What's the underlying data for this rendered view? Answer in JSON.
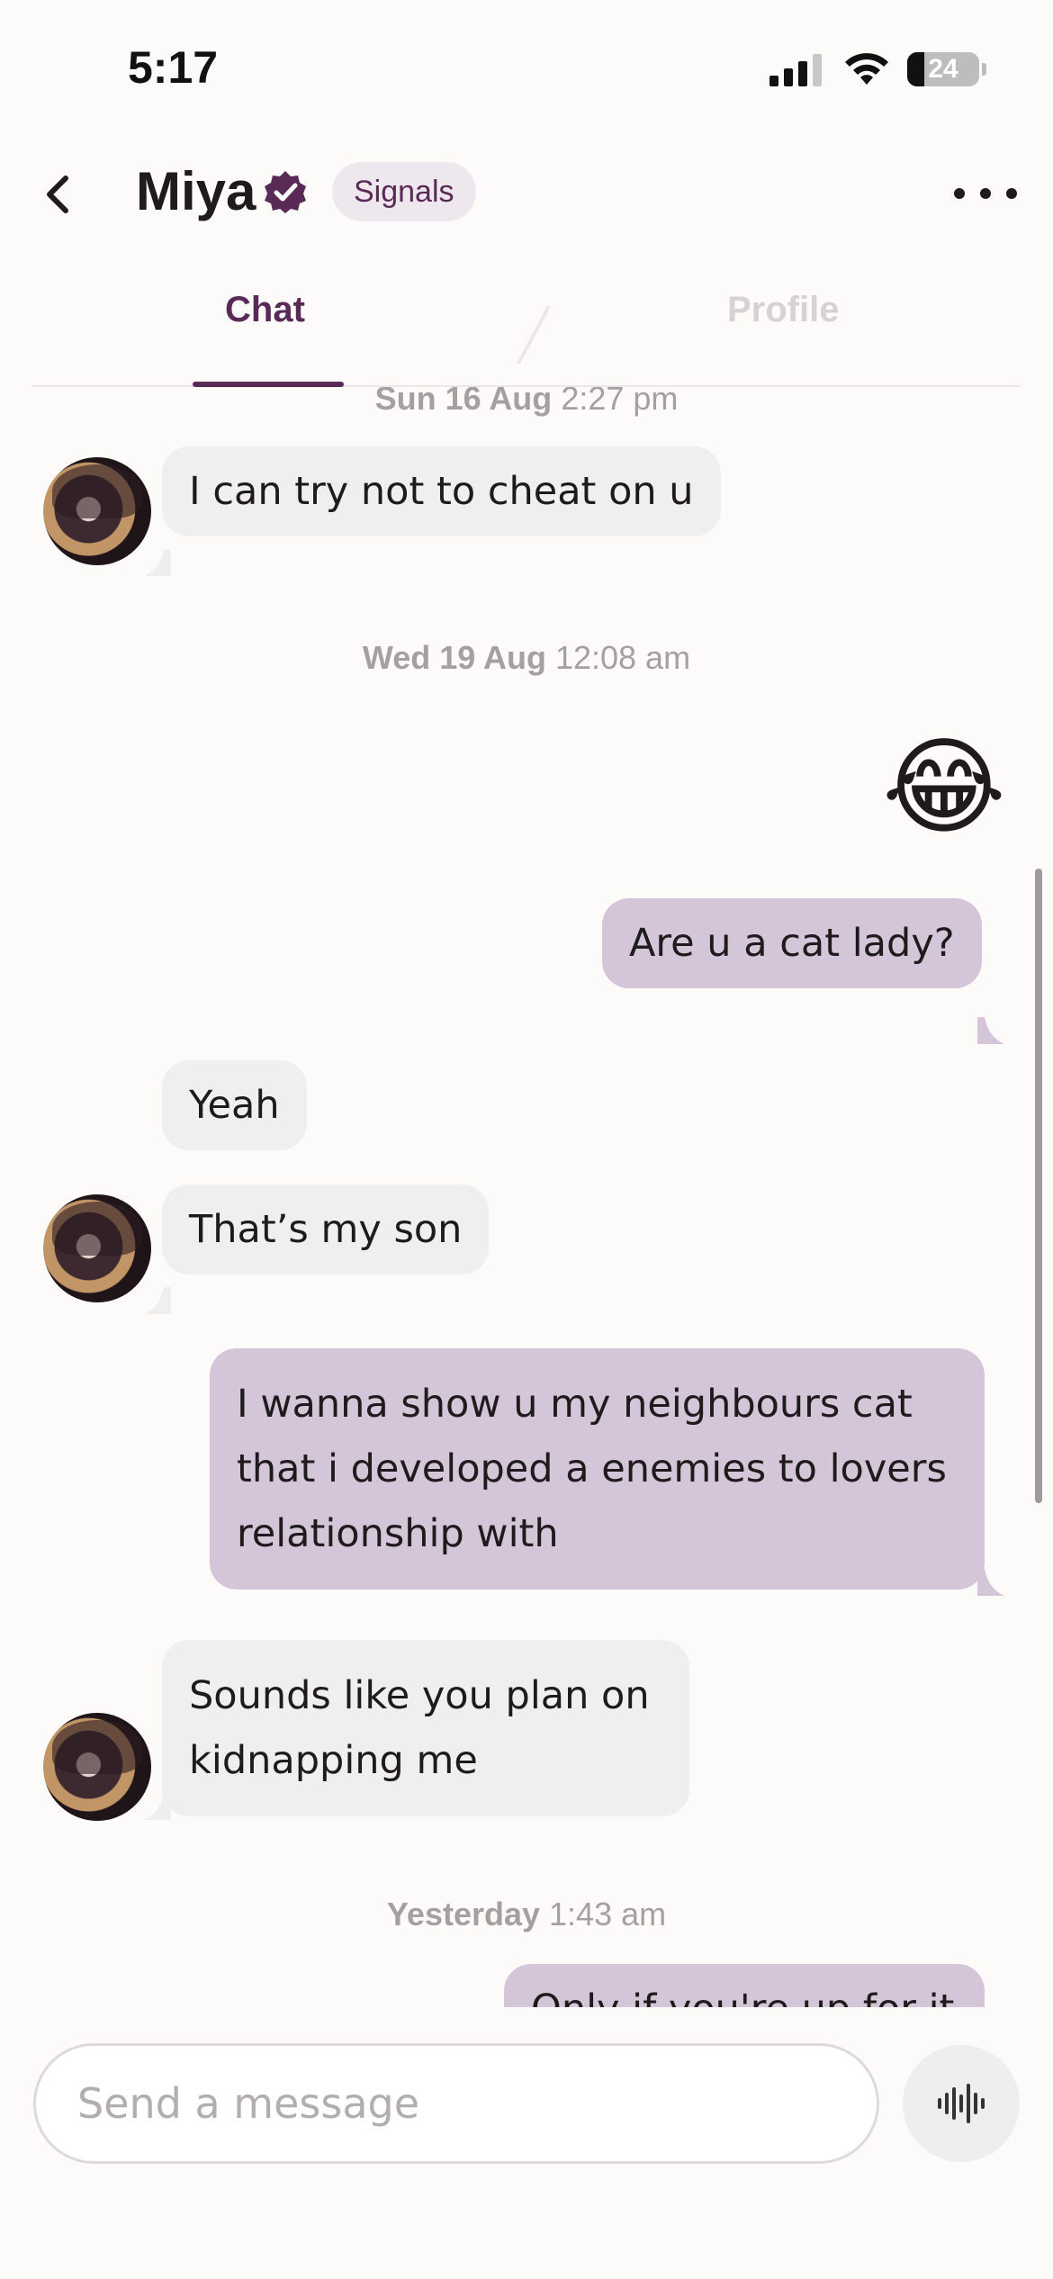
{
  "status_bar": {
    "time": "5:17",
    "battery_level": "24",
    "battery_fraction": 0.24
  },
  "header": {
    "name": "Miya",
    "badge": "Signals",
    "icons": {
      "back": "chevron-left-icon",
      "verified": "verified-badge-icon",
      "more": "more-horizontal-icon"
    }
  },
  "tabs": {
    "chat": "Chat",
    "profile": "Profile",
    "active": "chat"
  },
  "conversation": {
    "timestamps": [
      {
        "date": "Sun 16 Aug",
        "time": "2:27 pm"
      },
      {
        "date": "Wed 19 Aug",
        "time": "12:08 am"
      },
      {
        "date": "Yesterday",
        "time": "1:43 am"
      }
    ],
    "messages": [
      {
        "from": "them",
        "text": "I can try not to cheat on u"
      },
      {
        "from": "me",
        "text": "😂",
        "type": "emoji"
      },
      {
        "from": "me",
        "text": "Are u a cat lady?"
      },
      {
        "from": "them",
        "text": "Yeah"
      },
      {
        "from": "them",
        "text": "That’s my son"
      },
      {
        "from": "me",
        "lines": [
          "I wanna show u my neighbours cat",
          "that i developed a enemies to lovers",
          "relationship with"
        ]
      },
      {
        "from": "them",
        "lines": [
          "Sounds like you plan on",
          "kidnapping me"
        ]
      },
      {
        "from": "me",
        "text": "Only if you're up for it 😉",
        "partially_visible": true
      }
    ]
  },
  "composer": {
    "placeholder": "Send a message",
    "voice_icon": "audio-waveform-icon"
  },
  "colors": {
    "accent": "#5a2a57",
    "outgoing_bubble": "#d4c5d8",
    "incoming_bubble": "#efefef",
    "badge_bg": "#eee8ee"
  }
}
